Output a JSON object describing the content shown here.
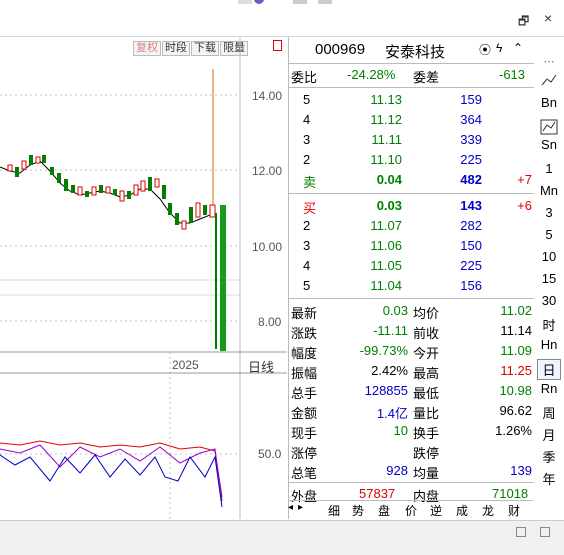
{
  "window": {
    "restore_icon": "restore-icon",
    "close_icon": "close-icon",
    "close_label": "×",
    "restore_label": "🗗"
  },
  "toolbar": {
    "buttons": [
      "复权",
      "时段",
      "下载",
      "限量"
    ]
  },
  "chart": {
    "y_ticks": [
      "14.00",
      "12.00",
      "10.00",
      "8.00"
    ],
    "x_label": "2025",
    "period_label": "日线",
    "indicator_tick": "50.0"
  },
  "stock": {
    "code": "000969",
    "name": "安泰科技"
  },
  "weibi": {
    "label": "委比",
    "value": "-24.28%",
    "diff_label": "委差",
    "diff_value": "-613"
  },
  "asks": [
    {
      "level": "5",
      "price": "11.13",
      "vol": "159"
    },
    {
      "level": "4",
      "price": "11.12",
      "vol": "364"
    },
    {
      "level": "3",
      "price": "11.11",
      "vol": "339"
    },
    {
      "level": "2",
      "price": "11.10",
      "vol": "225"
    },
    {
      "level": "卖",
      "price": "0.04",
      "vol": "482",
      "delta": "+7"
    }
  ],
  "bids": [
    {
      "level": "买",
      "price": "0.03",
      "vol": "143",
      "delta": "+6"
    },
    {
      "level": "2",
      "price": "11.07",
      "vol": "282"
    },
    {
      "level": "3",
      "price": "11.06",
      "vol": "150"
    },
    {
      "level": "4",
      "price": "11.05",
      "vol": "225"
    },
    {
      "level": "5",
      "price": "11.04",
      "vol": "156"
    }
  ],
  "stats": [
    {
      "l1": "最新",
      "v1": "0.03",
      "c1": "green",
      "l2": "均价",
      "v2": "11.02",
      "c2": "green"
    },
    {
      "l1": "涨跌",
      "v1": "-11.11",
      "c1": "green",
      "l2": "前收",
      "v2": "11.14",
      "c2": "black"
    },
    {
      "l1": "幅度",
      "v1": "-99.73%",
      "c1": "green",
      "l2": "今开",
      "v2": "11.09",
      "c2": "green"
    },
    {
      "l1": "振幅",
      "v1": "2.42%",
      "c1": "black",
      "l2": "最高",
      "v2": "11.25",
      "c2": "red"
    },
    {
      "l1": "总手",
      "v1": "128855",
      "c1": "blue",
      "l2": "最低",
      "v2": "10.98",
      "c2": "green"
    },
    {
      "l1": "金额",
      "v1": "1.4亿",
      "c1": "blue",
      "l2": "量比",
      "v2": "96.62",
      "c2": "black"
    },
    {
      "l1": "现手",
      "v1": "10",
      "c1": "green",
      "l2": "换手",
      "v2": "1.26%",
      "c2": "black"
    },
    {
      "l1": "涨停",
      "v1": "",
      "c1": "black",
      "l2": "跌停",
      "v2": "",
      "c2": "black"
    },
    {
      "l1": "总笔",
      "v1": "928",
      "c1": "blue",
      "l2": "均量",
      "v2": "139",
      "c2": "blue"
    }
  ],
  "outer": {
    "label": "外盘",
    "value": "57837",
    "inner_label": "内盘",
    "inner_value": "71018"
  },
  "bottom_tabs": [
    "细",
    "势",
    "盘",
    "价",
    "逆",
    "成",
    "龙",
    "财"
  ],
  "sidebar": [
    "Bn",
    "Sn",
    "1",
    "Mn",
    "3",
    "5",
    "10",
    "15",
    "30",
    "时",
    "Hn",
    "日",
    "Rn",
    "周",
    "月",
    "季",
    "年"
  ]
}
